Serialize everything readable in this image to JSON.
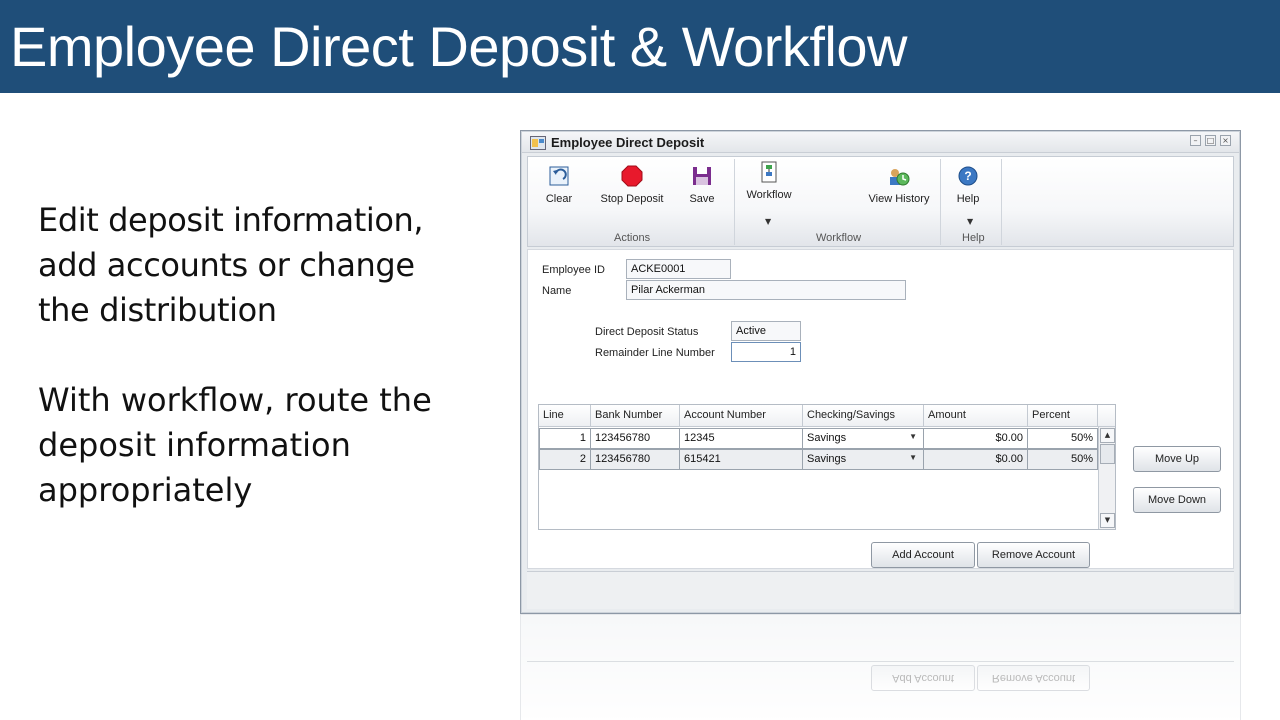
{
  "slide": {
    "title": "Employee Direct Deposit & Workflow",
    "bullet1": "Edit deposit information, add accounts or change the distribution",
    "bullet2": "With workflow, route the deposit information appropriately"
  },
  "window": {
    "title": "Employee Direct Deposit",
    "controls": [
      "–",
      "□",
      "×"
    ]
  },
  "ribbon": {
    "clear": "Clear",
    "stop_deposit": "Stop Deposit",
    "save": "Save",
    "workflow": "Workflow",
    "view_history": "View History",
    "help": "Help",
    "groups": {
      "actions": "Actions",
      "workflow": "Workflow",
      "help": "Help"
    }
  },
  "form": {
    "employee_id_label": "Employee ID",
    "employee_id": "ACKE0001",
    "name_label": "Name",
    "name": "Pilar Ackerman",
    "status_label": "Direct Deposit Status",
    "status": "Active",
    "remainder_label": "Remainder Line Number",
    "remainder": "1"
  },
  "grid": {
    "headers": [
      "Line",
      "Bank Number",
      "Account Number",
      "Checking/Savings",
      "Amount",
      "Percent"
    ],
    "rows": [
      {
        "line": "1",
        "bank": "123456780",
        "account": "12345",
        "type": "Savings",
        "amount": "$0.00",
        "percent": "50%"
      },
      {
        "line": "2",
        "bank": "123456780",
        "account": "615421",
        "type": "Savings",
        "amount": "$0.00",
        "percent": "50%"
      }
    ]
  },
  "buttons": {
    "move_up": "Move Up",
    "move_down": "Move Down",
    "add_account": "Add Account",
    "remove_account": "Remove Account"
  },
  "colors": {
    "header_bg": "#1f4e79",
    "stop_red": "#e8192c",
    "save_purple": "#7b2d8e"
  },
  "icons": [
    "undo-icon",
    "stop-icon",
    "floppy-disk-icon",
    "workflow-icon",
    "view-history-icon",
    "help-icon"
  ]
}
